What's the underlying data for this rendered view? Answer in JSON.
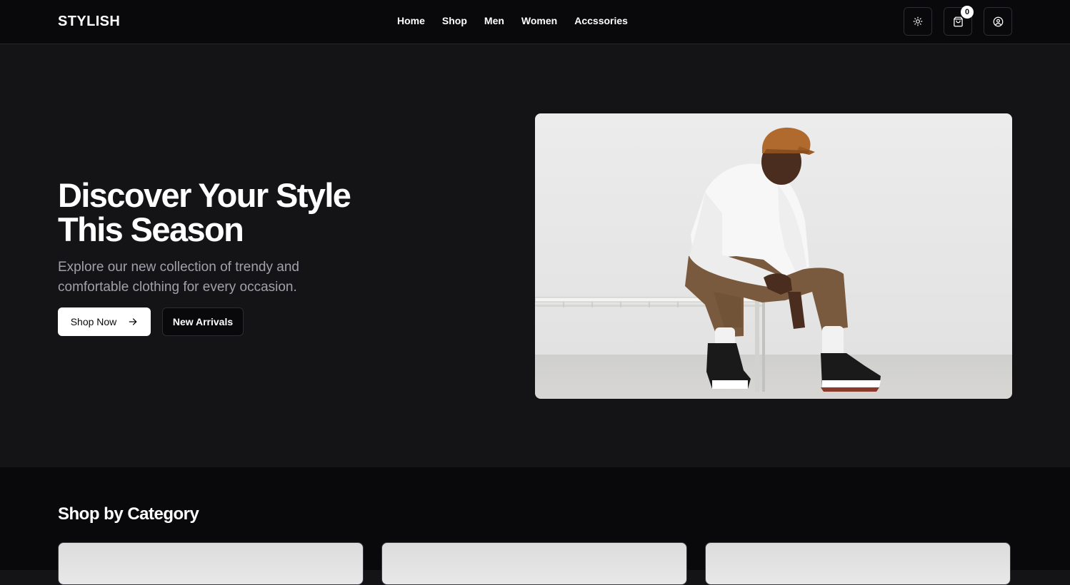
{
  "header": {
    "logo": "STYLISH",
    "nav": [
      {
        "label": "Home"
      },
      {
        "label": "Shop"
      },
      {
        "label": "Men"
      },
      {
        "label": "Women"
      },
      {
        "label": "Accssories"
      }
    ],
    "cart_count": "0",
    "icons": {
      "theme": "sun-icon",
      "cart": "shopping-bag-icon",
      "user": "user-circle-icon"
    }
  },
  "hero": {
    "title": "Discover Your Style This Season",
    "subtitle": "Explore our new collection of trendy and comfortable clothing for every occasion.",
    "primary_button": "Shop Now",
    "secondary_button": "New Arrivals",
    "primary_button_icon": "arrow-right-icon"
  },
  "category": {
    "title": "Shop by Category"
  },
  "colors": {
    "header_bg": "#09090b",
    "hero_bg": "#141416",
    "text_primary": "#ffffff",
    "text_muted": "#a1a1aa",
    "button_light": "#ffffff"
  }
}
